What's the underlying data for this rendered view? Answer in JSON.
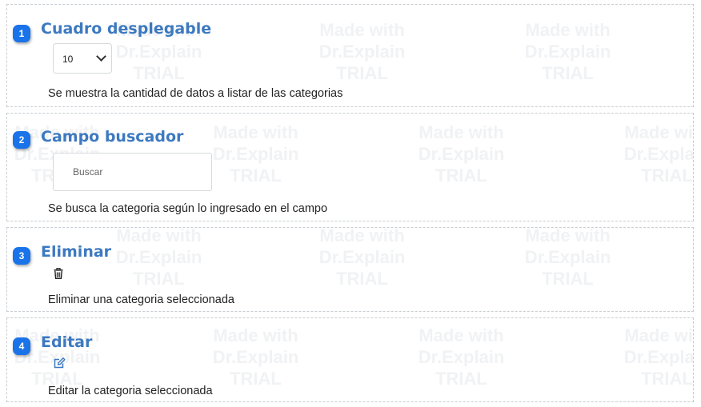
{
  "watermark": {
    "line1": "Made with",
    "line2": "Dr.Explain",
    "line3": "TRIAL"
  },
  "sections": [
    {
      "number": "1",
      "title": "Cuadro desplegable",
      "description": "Se muestra la cantidad de datos a listar de las categorias",
      "control": {
        "type": "select",
        "value": "10"
      }
    },
    {
      "number": "2",
      "title": "Campo buscador",
      "description": "Se busca la categoria según lo ingresado en el campo",
      "control": {
        "type": "input",
        "placeholder": "Buscar"
      }
    },
    {
      "number": "3",
      "title": "Eliminar",
      "description": "Eliminar una categoria seleccionada",
      "control": {
        "type": "icon",
        "icon": "trash-icon"
      }
    },
    {
      "number": "4",
      "title": "Editar",
      "description": "Editar la categoria seleccionada",
      "control": {
        "type": "icon",
        "icon": "edit-icon"
      }
    }
  ],
  "colors": {
    "badge": "#1a73e8",
    "title": "#3d79c0",
    "edit_icon": "#3d79c0"
  }
}
